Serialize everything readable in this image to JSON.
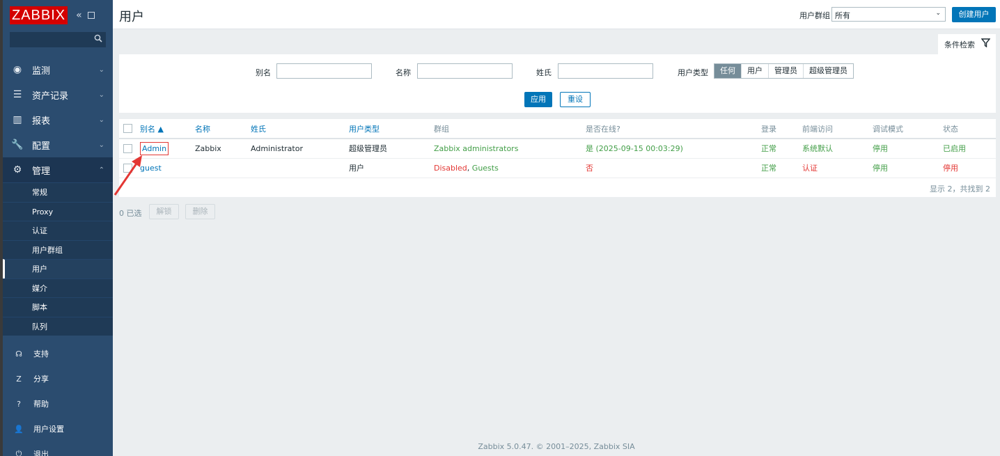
{
  "sidebar": {
    "logo": "ZABBIX",
    "collapse_icon": "«",
    "menu": [
      {
        "label": "监测",
        "icon": "eye-icon",
        "glyph": "◉"
      },
      {
        "label": "资产记录",
        "icon": "list-icon",
        "glyph": "☰"
      },
      {
        "label": "报表",
        "icon": "chart-icon",
        "glyph": "▥"
      },
      {
        "label": "配置",
        "icon": "wrench-icon",
        "glyph": "🔧"
      },
      {
        "label": "管理",
        "icon": "gear-icon",
        "glyph": "⚙"
      }
    ],
    "submenu": [
      "常规",
      "Proxy",
      "认证",
      "用户群组",
      "用户",
      "媒介",
      "脚本",
      "队列"
    ],
    "bottom": [
      {
        "label": "支持",
        "glyph": "☊"
      },
      {
        "label": "分享",
        "glyph": "Z"
      },
      {
        "label": "帮助",
        "glyph": "?"
      },
      {
        "label": "用户设置",
        "glyph": "👤"
      },
      {
        "label": "退出",
        "glyph": "⏻"
      }
    ]
  },
  "header": {
    "title": "用户",
    "group_label": "用户群组",
    "group_value": "所有",
    "create_button": "创建用户"
  },
  "filter": {
    "tab_label": "条件检索",
    "alias_label": "别名",
    "name_label": "名称",
    "surname_label": "姓氏",
    "type_label": "用户类型",
    "type_options": [
      "任何",
      "用户",
      "管理员",
      "超级管理员"
    ],
    "type_selected": "任何",
    "apply": "应用",
    "reset": "重设"
  },
  "table": {
    "headers": [
      "别名 ▲",
      "名称",
      "姓氏",
      "用户类型",
      "群组",
      "是否在线?",
      "登录",
      "前端访问",
      "调试模式",
      "状态"
    ],
    "rows": [
      {
        "alias": "Admin",
        "name": "Zabbix",
        "surname": "Administrator",
        "type": "超级管理员",
        "groups": "Zabbix administrators",
        "online": "是 (2025-09-15 00:03:29)",
        "login": "正常",
        "frontend": "系统默认",
        "debug": "停用",
        "status": "已启用"
      },
      {
        "alias": "guest",
        "name": "",
        "surname": "",
        "type": "用户",
        "group1": "Disabled",
        "group_sep": ", ",
        "group2": "Guests",
        "online": "否",
        "login": "正常",
        "frontend": "认证",
        "debug": "停用",
        "status": "停用"
      }
    ],
    "showing": "显示 2，共找到 2"
  },
  "actions": {
    "selected": "0 已选",
    "unblock": "解锁",
    "delete": "删除"
  },
  "footer": "Zabbix 5.0.47. © 2001–2025, Zabbix SIA"
}
